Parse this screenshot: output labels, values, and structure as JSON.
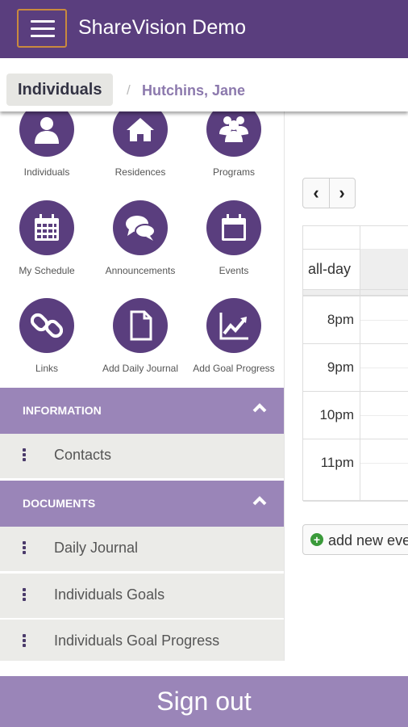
{
  "app": {
    "title": "ShareVision Demo"
  },
  "breadcrumb": {
    "root": "Individuals",
    "separator": "/",
    "current": "Hutchins, Jane"
  },
  "tiles": [
    {
      "label": "Individuals",
      "icon": "person-icon"
    },
    {
      "label": "Residences",
      "icon": "home-icon"
    },
    {
      "label": "Programs",
      "icon": "group-icon"
    },
    {
      "label": "My Schedule",
      "icon": "calendar-grid-icon"
    },
    {
      "label": "Announcements",
      "icon": "chat-bubbles-icon"
    },
    {
      "label": "Events",
      "icon": "calendar-icon"
    },
    {
      "label": "Links",
      "icon": "link-icon"
    },
    {
      "label": "Add Daily Journal",
      "icon": "document-icon"
    },
    {
      "label": "Add Goal Progress",
      "icon": "chart-line-icon"
    }
  ],
  "sections": {
    "information": {
      "title": "INFORMATION",
      "items": [
        "Contacts"
      ]
    },
    "documents": {
      "title": "DOCUMENTS",
      "items": [
        "Daily Journal",
        "Individuals Goals",
        "Individuals Goal Progress"
      ]
    }
  },
  "calendar": {
    "prev": "‹",
    "next": "›",
    "allday_label": "all-day",
    "hours": [
      "8pm",
      "9pm",
      "10pm",
      "11pm"
    ],
    "add_event": "add new eve"
  },
  "signout_label": "Sign out",
  "colors": {
    "primary": "#5a3e7e",
    "secondary": "#9a85b8",
    "breadcrumb_current": "#8c79ad"
  }
}
